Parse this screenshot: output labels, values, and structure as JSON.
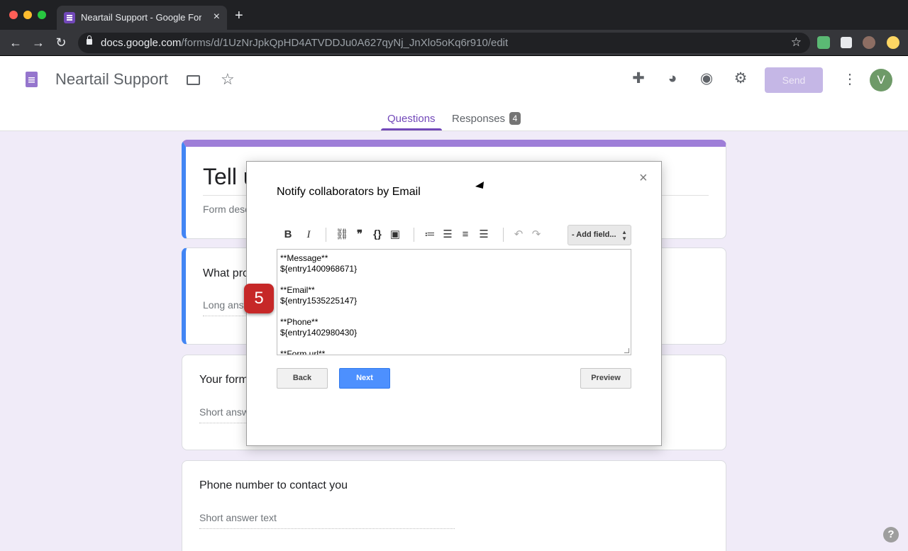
{
  "browser": {
    "tab_title": "Neartail Support - Google Form",
    "tab_close": "×",
    "new_tab": "+",
    "url_host": "docs.google.com",
    "url_path": "/forms/d/1UzNrJpkQpHD4ATVDDJu0A627qyNj_JnXlo5oKq6r910/edit",
    "back": "←",
    "forward": "→",
    "reload": "↻",
    "bookmark": "☆"
  },
  "header": {
    "form_title": "Neartail Support",
    "send_label": "Send",
    "avatar_initial": "V",
    "more": "⋮",
    "tabs": [
      {
        "label": "Questions",
        "active": true
      },
      {
        "label": "Responses",
        "badge": "4"
      }
    ]
  },
  "cards": {
    "title_card": {
      "title": "Tell u",
      "description": "Form desc"
    },
    "questions": [
      {
        "title": "What pro",
        "answer": "Long answ"
      },
      {
        "title": "Your form",
        "answer": "Short answ"
      },
      {
        "title": "Phone number to contact you",
        "answer": "Short answer text"
      }
    ]
  },
  "dialog": {
    "title": "Notify collaborators by Email",
    "close": "×",
    "add_field": "- Add field...",
    "editor_lines": [
      "**Message**",
      "${entry1400968671}",
      "",
      "**Email**",
      "${entry1535225147}",
      "",
      "**Phone**",
      "${entry1402980430}",
      "",
      "**Form url**"
    ],
    "back_label": "Back",
    "next_label": "Next",
    "preview_label": "Preview"
  },
  "overlay": {
    "step_number": "5"
  },
  "help": "?"
}
